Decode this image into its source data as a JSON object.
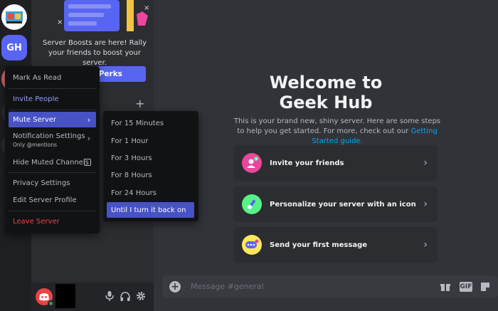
{
  "servers": {
    "gh_initials": "GH"
  },
  "sidebar": {
    "boost_text": "Server Boosts are here! Rally your friends to boost your server.",
    "boost_button_label": "k Perks",
    "add_channel_symbol": "+"
  },
  "context_menu": {
    "items": [
      {
        "label": "Mark As Read"
      },
      {
        "label": "Invite People"
      },
      {
        "label": "Mute Server"
      },
      {
        "label": "Notification Settings",
        "sublabel": "Only @mentions"
      },
      {
        "label": "Hide Muted Channels"
      },
      {
        "label": "Privacy Settings"
      },
      {
        "label": "Edit Server Profile"
      },
      {
        "label": "Leave Server"
      }
    ]
  },
  "mute_submenu": {
    "items": [
      {
        "label": "For 15 Minutes"
      },
      {
        "label": "For 1 Hour"
      },
      {
        "label": "For 3 Hours"
      },
      {
        "label": "For 8 Hours"
      },
      {
        "label": "For 24 Hours"
      },
      {
        "label": "Until I turn it back on"
      }
    ]
  },
  "main": {
    "title_line1": "Welcome to",
    "title_line2": "Geek Hub",
    "description": "This is your brand new, shiny server. Here are some steps to help you get started. For more, check out our ",
    "description_link": "Getting Started guide.",
    "cards": [
      {
        "label": "Invite your friends",
        "icon": "invite-friends-icon"
      },
      {
        "label": "Personalize your server with an icon",
        "icon": "paintbrush-icon"
      },
      {
        "label": "Send your first message",
        "icon": "chat-bubble-icon"
      }
    ],
    "composer_placeholder": "Message #general",
    "gif_label": "GIF"
  },
  "colors": {
    "accent": "#5865f2",
    "danger": "#f23f43",
    "link": "#00a8fc",
    "online": "#23a55a"
  }
}
